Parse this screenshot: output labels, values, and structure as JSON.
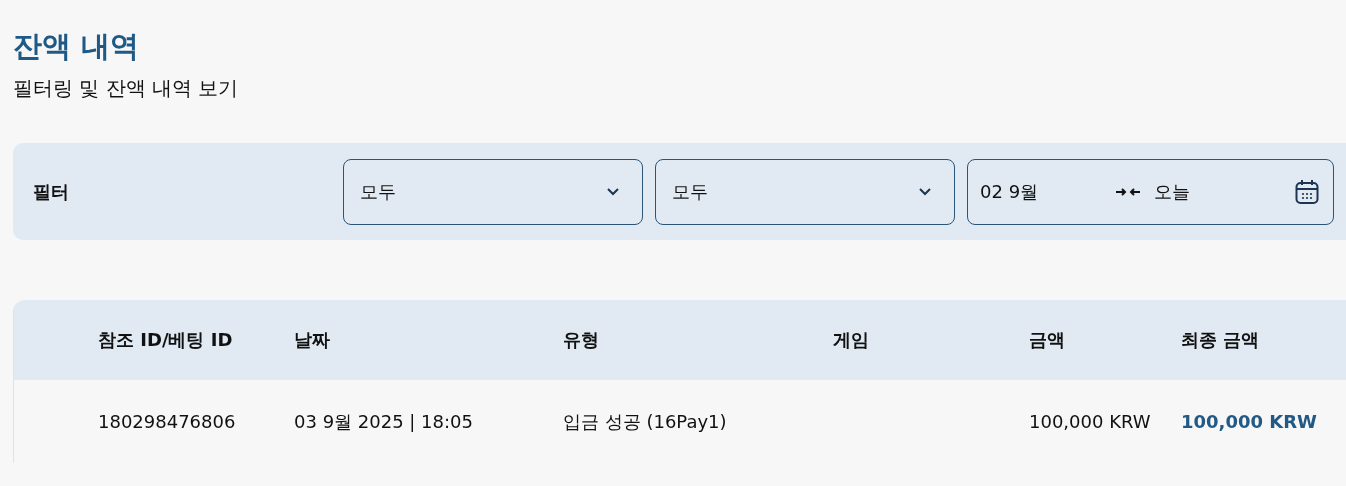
{
  "header": {
    "title": "잔액 내역",
    "subtitle": "필터링 및 잔액 내역 보기"
  },
  "filter": {
    "label": "필터",
    "selects": [
      {
        "value": "모두"
      },
      {
        "value": "모두"
      }
    ],
    "date_range": {
      "start": "02 9월",
      "end": "오늘"
    }
  },
  "table": {
    "columns": [
      "참조 ID/베팅 ID",
      "날짜",
      "유형",
      "게임",
      "금액",
      "최종 금액"
    ],
    "rows": [
      {
        "reference_id": "180298476806",
        "date": "03 9월 2025 | 18:05",
        "type": "입금 성공 (16Pay1)",
        "amount": "100,000 KRW",
        "final_amount": "100,000 KRW"
      }
    ]
  }
}
